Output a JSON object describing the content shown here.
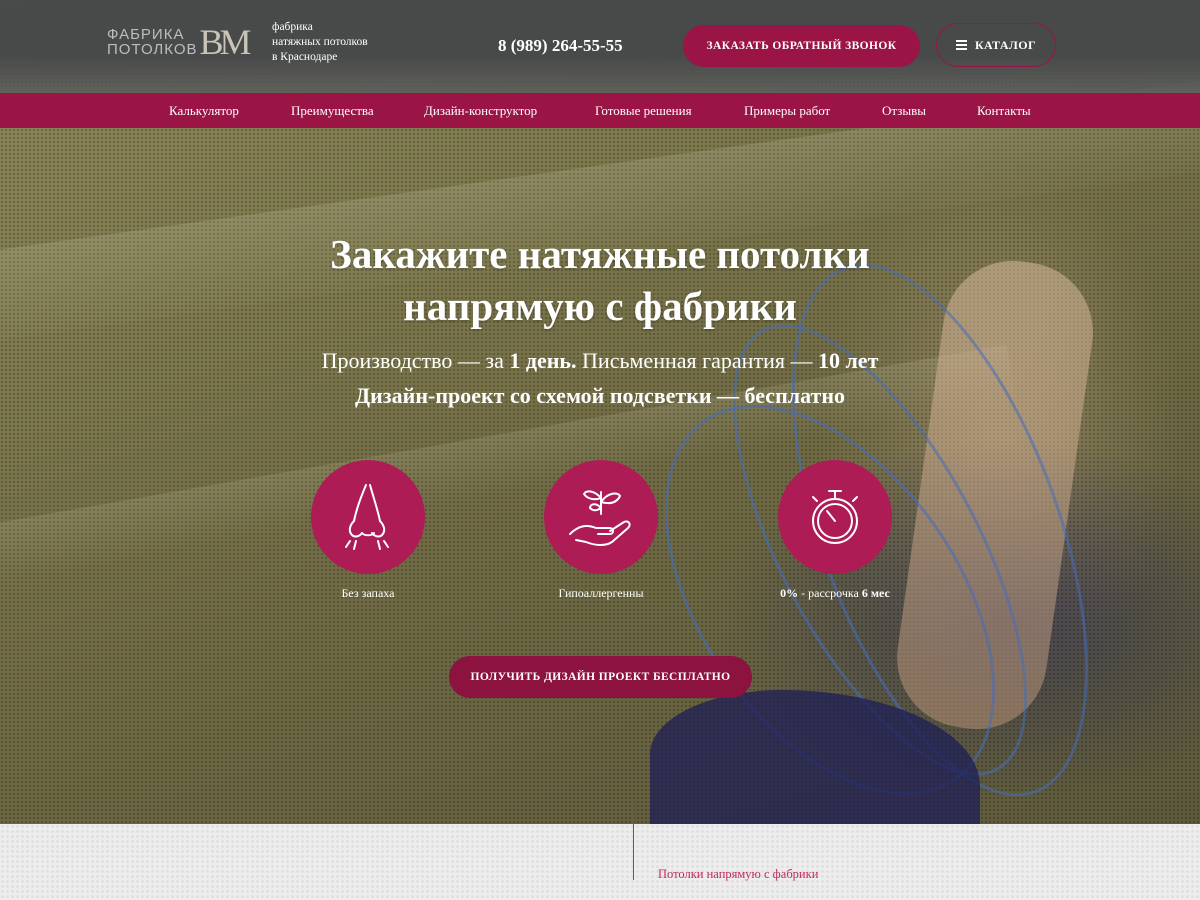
{
  "header": {
    "logo": {
      "line1": "ФАБРИКА",
      "line2": "ПОТОЛКОВ",
      "mark": "BM"
    },
    "tagline": [
      "фабрика",
      "натяжных потолков",
      "в Краснодаре"
    ],
    "phone": "8 (989) 264-55-55",
    "callback_label": "ЗАКАЗАТЬ ОБРАТНЫЙ ЗВОНОК",
    "catalog_label": "КАТАЛОГ"
  },
  "nav": {
    "items": [
      {
        "label": "Калькулятор"
      },
      {
        "label": "Преимущества"
      },
      {
        "label": "Дизайн-конструктор"
      },
      {
        "label": "Готовые решения"
      },
      {
        "label": "Примеры работ"
      },
      {
        "label": "Отзывы"
      },
      {
        "label": "Контакты"
      }
    ]
  },
  "hero": {
    "title_line1": "Закажите натяжные потолки",
    "title_line2": "напрямую с фабрики",
    "sub1_a": "Производство — за ",
    "sub1_b": "1 день.",
    "sub1_c": " Письменная гарантия — ",
    "sub1_d": "10 лет",
    "sub2": "Дизайн-проект со схемой подсветки — бесплатно",
    "features": [
      {
        "icon": "nose-icon",
        "label": "Без запаха"
      },
      {
        "icon": "hand-leaf-icon",
        "label": "Гипоаллергенны"
      },
      {
        "icon": "stopwatch-icon",
        "label_a": "0%",
        "label_b": " - рассрочка ",
        "label_c": "6 мес"
      }
    ],
    "cta_label": "ПОЛУЧИТЬ ДИЗАЙН ПРОЕКТ БЕСПЛАТНО"
  },
  "lower": {
    "caption": "Потолки напрямую с фабрики"
  },
  "colors": {
    "brand": "#9b1446",
    "circle": "#ad1c55",
    "header_bg": "#46484a"
  }
}
